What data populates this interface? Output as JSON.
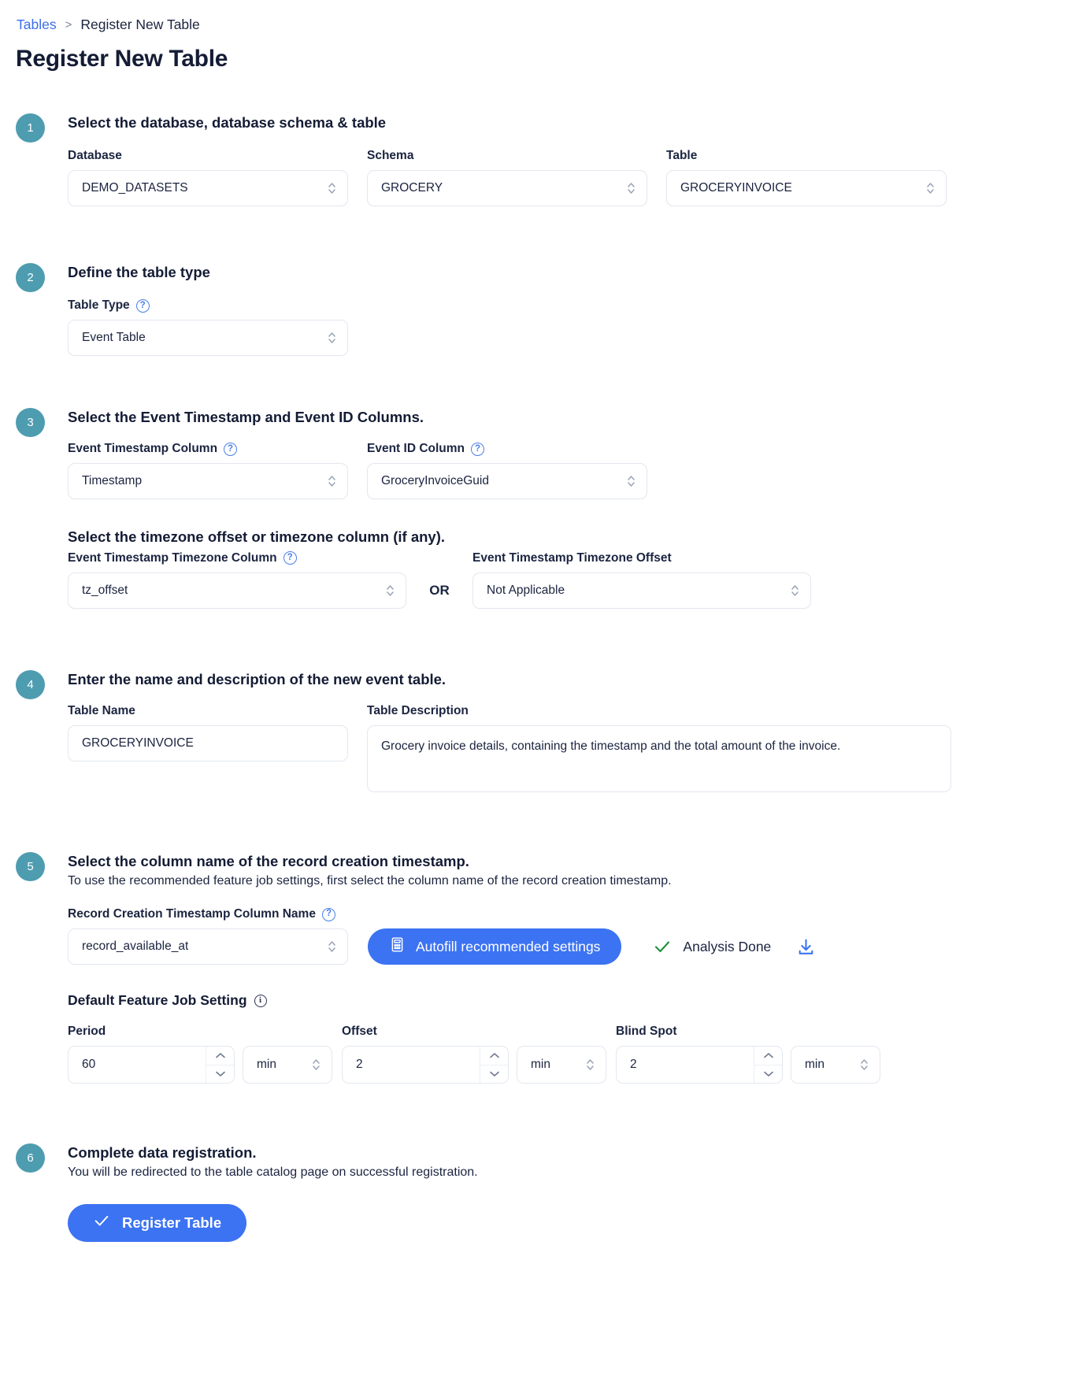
{
  "breadcrumb": {
    "parent": "Tables",
    "separator": ">",
    "current": "Register New Table"
  },
  "page_title": "Register New Table",
  "colors": {
    "accent_blue": "#3c73f2",
    "badge_teal": "#4e9cb0",
    "link_blue": "#3b6fe8",
    "success_green": "#1e8f3b"
  },
  "steps": [
    {
      "number": "1",
      "title": "Select the database, database schema & table",
      "fields": {
        "database": {
          "label": "Database",
          "value": "DEMO_DATASETS"
        },
        "schema": {
          "label": "Schema",
          "value": "GROCERY"
        },
        "table": {
          "label": "Table",
          "value": "GROCERYINVOICE"
        }
      }
    },
    {
      "number": "2",
      "title": "Define the table type",
      "fields": {
        "table_type": {
          "label": "Table Type",
          "value": "Event Table",
          "help": "?"
        }
      }
    },
    {
      "number": "3",
      "title": "Select the Event Timestamp and Event ID Columns.",
      "subheading": "Select the timezone offset or timezone column (if any).",
      "or_label": "OR",
      "fields": {
        "event_timestamp_column": {
          "label": "Event Timestamp Column",
          "value": "Timestamp",
          "help": "?"
        },
        "event_id_column": {
          "label": "Event ID Column",
          "value": "GroceryInvoiceGuid",
          "help": "?"
        },
        "event_timestamp_timezone_column": {
          "label": "Event Timestamp Timezone Column",
          "value": "tz_offset",
          "help": "?"
        },
        "event_timestamp_timezone_offset": {
          "label": "Event Timestamp Timezone Offset",
          "value": "Not Applicable"
        }
      }
    },
    {
      "number": "4",
      "title": "Enter the name and description of the new event table.",
      "fields": {
        "table_name": {
          "label": "Table Name",
          "value": "GROCERYINVOICE"
        },
        "table_description": {
          "label": "Table Description",
          "value": "Grocery invoice details, containing the timestamp and the total amount of the invoice."
        }
      }
    },
    {
      "number": "5",
      "title": "Select the column name of the record creation timestamp.",
      "subtitle": "To use the recommended feature job settings, first select the column name of the record creation timestamp.",
      "fields": {
        "record_creation_timestamp_column_name": {
          "label": "Record Creation Timestamp Column Name",
          "value": "record_available_at",
          "help": "?"
        }
      },
      "autofill_button": "Autofill recommended settings",
      "analysis_status": "Analysis Done",
      "feature_job_setting": {
        "title": "Default Feature Job Setting",
        "info": "i",
        "period": {
          "label": "Period",
          "value": "60",
          "unit": "min"
        },
        "offset": {
          "label": "Offset",
          "value": "2",
          "unit": "min"
        },
        "blind_spot": {
          "label": "Blind Spot",
          "value": "2",
          "unit": "min"
        }
      }
    },
    {
      "number": "6",
      "title": "Complete data registration.",
      "subtitle": "You will be redirected to the table catalog page on successful registration.",
      "register_button": "Register Table"
    }
  ],
  "icons": {
    "chevron_updown": "chevron-up-down-icon",
    "help": "help-circle-icon",
    "info": "info-circle-icon",
    "calculator": "calculator-icon",
    "check": "check-icon",
    "download": "download-icon"
  }
}
